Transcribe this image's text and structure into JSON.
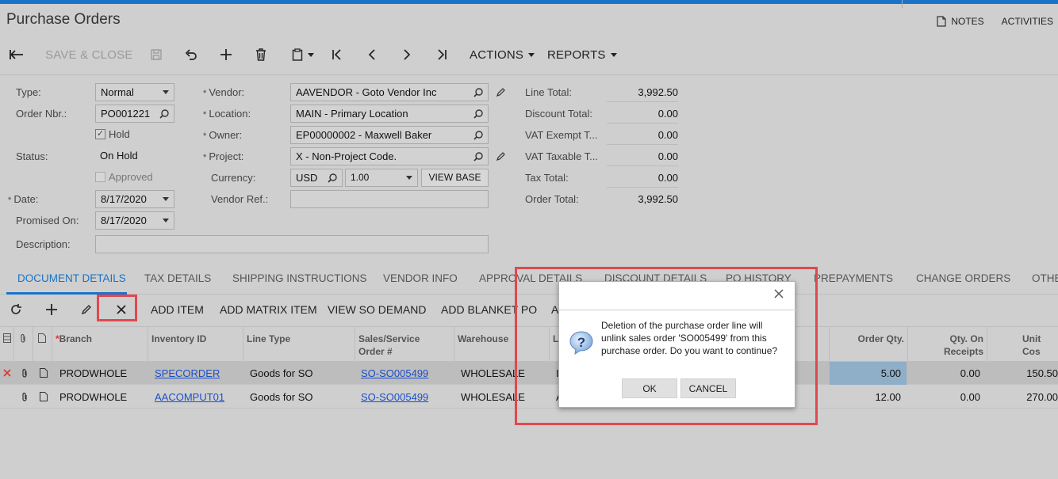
{
  "app": {
    "title": "Purchase Orders"
  },
  "top_actions": {
    "notes": "NOTES",
    "activities": "ACTIVITIES"
  },
  "toolbar": {
    "save_close": "SAVE & CLOSE",
    "actions": "ACTIONS",
    "reports": "REPORTS"
  },
  "form": {
    "type_label": "Type:",
    "type_value": "Normal",
    "order_nbr_label": "Order Nbr.:",
    "order_nbr_value": "PO001221",
    "hold_label": "Hold",
    "status_label": "Status:",
    "status_value": "On Hold",
    "approved_label": "Approved",
    "date_label": "Date:",
    "date_value": "8/17/2020",
    "promised_label": "Promised On:",
    "promised_value": "8/17/2020",
    "description_label": "Description:",
    "description_value": "",
    "vendor_label": "Vendor:",
    "vendor_value": "AAVENDOR - Goto Vendor Inc",
    "location_label": "Location:",
    "location_value": "MAIN - Primary Location",
    "owner_label": "Owner:",
    "owner_value": "EP00000002 - Maxwell Baker",
    "project_label": "Project:",
    "project_value": "X - Non-Project Code.",
    "currency_label": "Currency:",
    "currency_value": "USD",
    "rate_value": "1.00",
    "view_base": "VIEW BASE",
    "vendor_ref_label": "Vendor Ref.:",
    "vendor_ref_value": "",
    "line_total_label": "Line Total:",
    "line_total_value": "3,992.50",
    "discount_total_label": "Discount Total:",
    "discount_total_value": "0.00",
    "vat_exempt_label": "VAT Exempt T...",
    "vat_exempt_value": "0.00",
    "vat_taxable_label": "VAT Taxable T...",
    "vat_taxable_value": "0.00",
    "tax_total_label": "Tax Total:",
    "tax_total_value": "0.00",
    "order_total_label": "Order Total:",
    "order_total_value": "3,992.50"
  },
  "tabs": [
    "DOCUMENT DETAILS",
    "TAX DETAILS",
    "SHIPPING INSTRUCTIONS",
    "VENDOR INFO",
    "APPROVAL DETAILS",
    "DISCOUNT DETAILS",
    "PO HISTORY",
    "PREPAYMENTS",
    "CHANGE ORDERS",
    "OTHE"
  ],
  "grid_toolbar": {
    "add_item": "ADD ITEM",
    "add_matrix_item": "ADD MATRIX ITEM",
    "view_so_demand": "VIEW SO DEMAND",
    "add_blanket_po": "ADD BLANKET PO",
    "more": "A"
  },
  "grid": {
    "headers": {
      "branch": "Branch",
      "inventory_id": "Inventory ID",
      "line_type": "Line Type",
      "sales_order_1": "Sales/Service",
      "sales_order_2": "Order #",
      "warehouse": "Warehouse",
      "hidden": "L",
      "order_qty": "Order Qty.",
      "qty_on_1": "Qty. On",
      "qty_on_2": "Receipts",
      "unit_cost": "Unit Cos"
    },
    "rows": [
      {
        "branch": "PRODWHOLE",
        "inventory_id": "SPECORDER",
        "line_type": "Goods for SO",
        "sales_order": "SO-SO005499",
        "warehouse": "WHOLESALE",
        "hidden": "I",
        "order_qty": "5.00",
        "qty_on_receipts": "0.00",
        "unit_cost": "150.50"
      },
      {
        "branch": "PRODWHOLE",
        "inventory_id": "AACOMPUT01",
        "line_type": "Goods for SO",
        "sales_order": "SO-SO005499",
        "warehouse": "WHOLESALE",
        "hidden": "A",
        "order_qty": "12.00",
        "qty_on_receipts": "0.00",
        "unit_cost": "270.00"
      }
    ]
  },
  "dialog": {
    "message": "Deletion of the purchase order line will unlink sales order 'SO005499' from this purchase order. Do you want to continue?",
    "ok": "OK",
    "cancel": "CANCEL"
  },
  "colors": {
    "accent": "#1a73c8",
    "highlight_frame": "#e0484f",
    "link": "#1a4fc8"
  }
}
